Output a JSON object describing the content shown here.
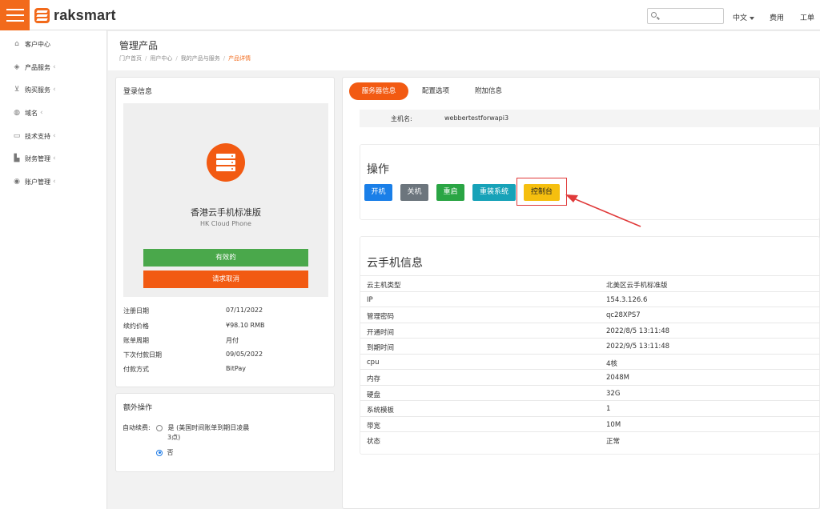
{
  "header": {
    "logo_text": "raksmart",
    "search_placeholder": "",
    "links": [
      "中文",
      "费用",
      "工单"
    ]
  },
  "sidebar": {
    "items": [
      {
        "label": "客户中心",
        "icon": "home-icon",
        "chevron": ""
      },
      {
        "label": "产品服务",
        "icon": "cube-icon",
        "chevron": "‹"
      },
      {
        "label": "购买服务",
        "icon": "cart-icon",
        "chevron": "‹"
      },
      {
        "label": "域名",
        "icon": "globe-icon",
        "chevron": "‹"
      },
      {
        "label": "技术支持",
        "icon": "monitor-icon",
        "chevron": "‹"
      },
      {
        "label": "财务管理",
        "icon": "briefcase-icon",
        "chevron": "‹"
      },
      {
        "label": "账户管理",
        "icon": "user-circle-icon",
        "chevron": "‹"
      }
    ]
  },
  "page": {
    "title": "管理产品",
    "breadcrumb": [
      "门户首页",
      "用户中心",
      "我的产品与服务",
      "产品详情"
    ]
  },
  "login_card": {
    "title": "登录信息",
    "product_name": "香港云手机标准版",
    "product_sub": "HK Cloud Phone",
    "status_label": "有效的",
    "cancel_label": "请求取消",
    "details": [
      {
        "k": "注册日期",
        "v": "07/11/2022"
      },
      {
        "k": "续约价格",
        "v": "¥98.10 RMB"
      },
      {
        "k": "账单周期",
        "v": "月付"
      },
      {
        "k": "下次付款日期",
        "v": "09/05/2022"
      },
      {
        "k": "付款方式",
        "v": "BitPay"
      }
    ]
  },
  "extra_card": {
    "title": "额外操作",
    "auto_renew_label": "自动续费:",
    "option_yes_line1": "是 (美国时间账单到期日凌晨",
    "option_yes_line2": "3点)",
    "option_no": "否",
    "selected": "否"
  },
  "tabs": [
    {
      "label": "服务器信息",
      "active": true
    },
    {
      "label": "配置选项",
      "active": false
    },
    {
      "label": "附加信息",
      "active": false
    }
  ],
  "hostname": {
    "label": "主机名:",
    "value": "webbertestforwapi3"
  },
  "operations": {
    "title": "操作",
    "buttons": [
      {
        "label": "开机",
        "color": "#1a7fe8"
      },
      {
        "label": "关机",
        "color": "#6c757d"
      },
      {
        "label": "重启",
        "color": "#2aa544"
      },
      {
        "label": "重装系统",
        "color": "#17a2b8"
      },
      {
        "label": "控制台",
        "color": "#f5bf0f"
      }
    ]
  },
  "cloud_info": {
    "title": "云手机信息",
    "rows": [
      {
        "k": "云主机类型",
        "v": "北美区云手机标准版"
      },
      {
        "k": "IP",
        "v": "154.3.126.6"
      },
      {
        "k": "管理密码",
        "v": "qc28XPS7"
      },
      {
        "k": "开通时间",
        "v": "2022/8/5 13:11:48"
      },
      {
        "k": "到期时间",
        "v": "2022/9/5 13:11:48"
      },
      {
        "k": "cpu",
        "v": "4核"
      },
      {
        "k": "内存",
        "v": "2048M"
      },
      {
        "k": "硬盘",
        "v": "32G"
      },
      {
        "k": "系统模板",
        "v": "1"
      },
      {
        "k": "带宽",
        "v": "10M"
      },
      {
        "k": "状态",
        "v": "正常"
      }
    ]
  },
  "colors": {
    "brand": "#f26a1b",
    "annotation": "#e03a3a"
  }
}
